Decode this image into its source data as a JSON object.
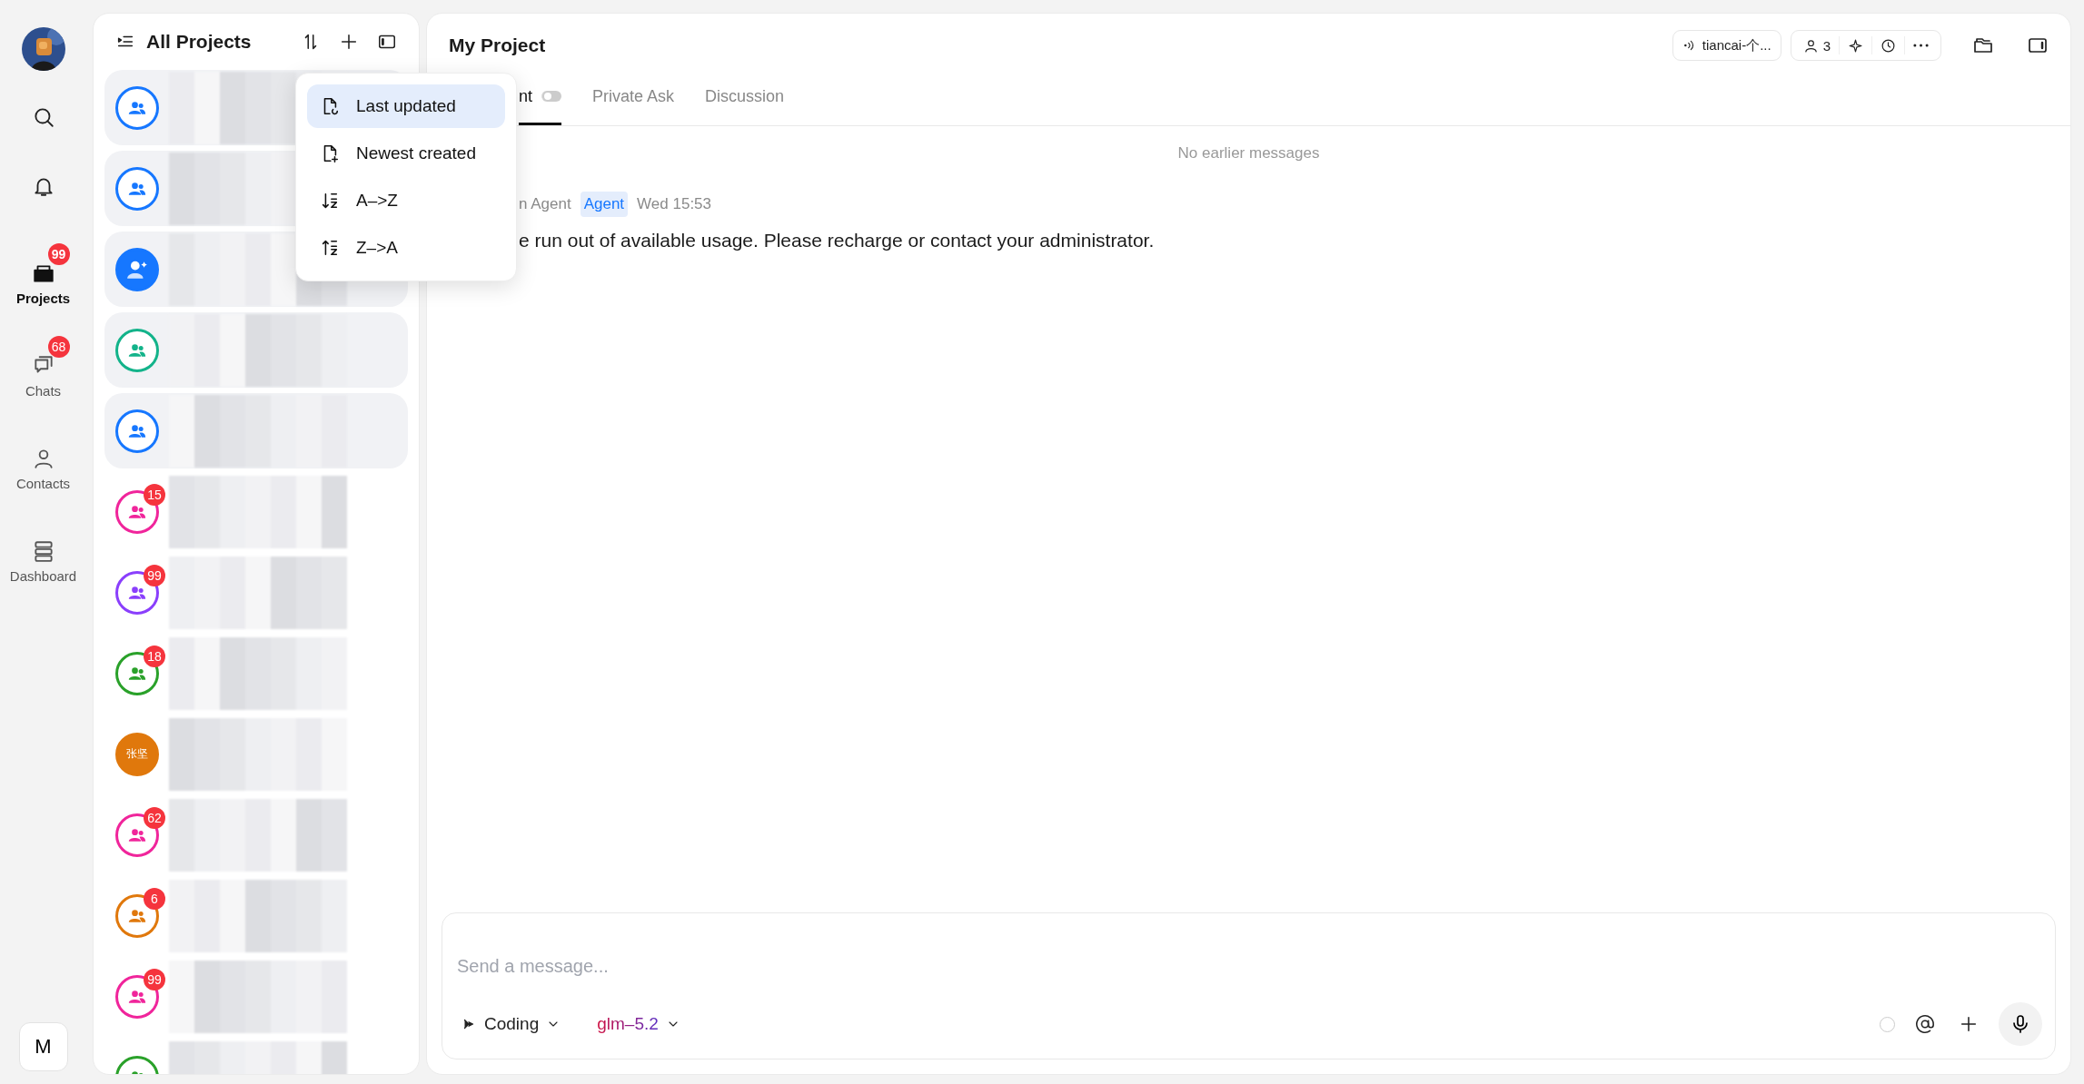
{
  "rail": {
    "items": [
      {
        "kind": "search"
      },
      {
        "kind": "bell"
      },
      {
        "kind": "projects",
        "label": "Projects",
        "badge": "99",
        "selected": true
      },
      {
        "kind": "chats",
        "label": "Chats",
        "badge": "68",
        "selected": false
      },
      {
        "kind": "contacts",
        "label": "Contacts",
        "selected": false
      },
      {
        "kind": "dashboard",
        "label": "Dashboard",
        "selected": false
      }
    ],
    "user_button": "M"
  },
  "projects": {
    "title": "All Projects",
    "items": [
      {
        "kind": "group",
        "color": "#1677ff",
        "highlighted": true
      },
      {
        "kind": "group",
        "color": "#1677ff",
        "highlighted": true
      },
      {
        "kind": "new",
        "color": "#1677ff",
        "highlighted": true
      },
      {
        "kind": "group",
        "color": "#13b38a",
        "highlighted": true
      },
      {
        "kind": "group",
        "color": "#1677ff",
        "highlighted": true
      },
      {
        "kind": "group",
        "color": "#f0259b",
        "badge": "15",
        "highlighted": false
      },
      {
        "kind": "group",
        "color": "#8a3ffc",
        "badge": "99",
        "highlighted": false
      },
      {
        "kind": "group",
        "color": "#2aa12a",
        "badge": "18",
        "highlighted": false
      },
      {
        "kind": "person",
        "color": "#e0780c",
        "initials": "张坚",
        "highlighted": false
      },
      {
        "kind": "group",
        "color": "#f0259b",
        "badge": "62",
        "highlighted": false
      },
      {
        "kind": "group",
        "color": "#e0780c",
        "badge": "6",
        "highlighted": false
      },
      {
        "kind": "group",
        "color": "#f0259b",
        "badge": "99",
        "highlighted": false
      },
      {
        "kind": "group",
        "color": "#2aa12a",
        "highlighted": false
      }
    ]
  },
  "sort_menu": {
    "items": [
      {
        "kind": "updated",
        "label": "Last updated",
        "selected": true
      },
      {
        "kind": "created",
        "label": "Newest created",
        "selected": false
      },
      {
        "kind": "az",
        "label": "A–>Z",
        "selected": false
      },
      {
        "kind": "za",
        "label": "Z–>A",
        "selected": false
      }
    ]
  },
  "main": {
    "title": "My Project",
    "model_chip": "tiancai-个...",
    "members": "3",
    "tabs": [
      {
        "label": "nt",
        "selected": true,
        "toggle": false
      },
      {
        "label": "Private Ask",
        "selected": false
      },
      {
        "label": "Discussion",
        "selected": false
      }
    ],
    "notice": "No earlier messages",
    "message": {
      "sender": "n Agent",
      "tag": "Agent",
      "time": "Wed 15:53",
      "text": "e run out of available usage. Please recharge or contact your administrator."
    },
    "composer": {
      "placeholder": "Send a message...",
      "mode": "Coding",
      "model": "glm–5.2"
    }
  }
}
